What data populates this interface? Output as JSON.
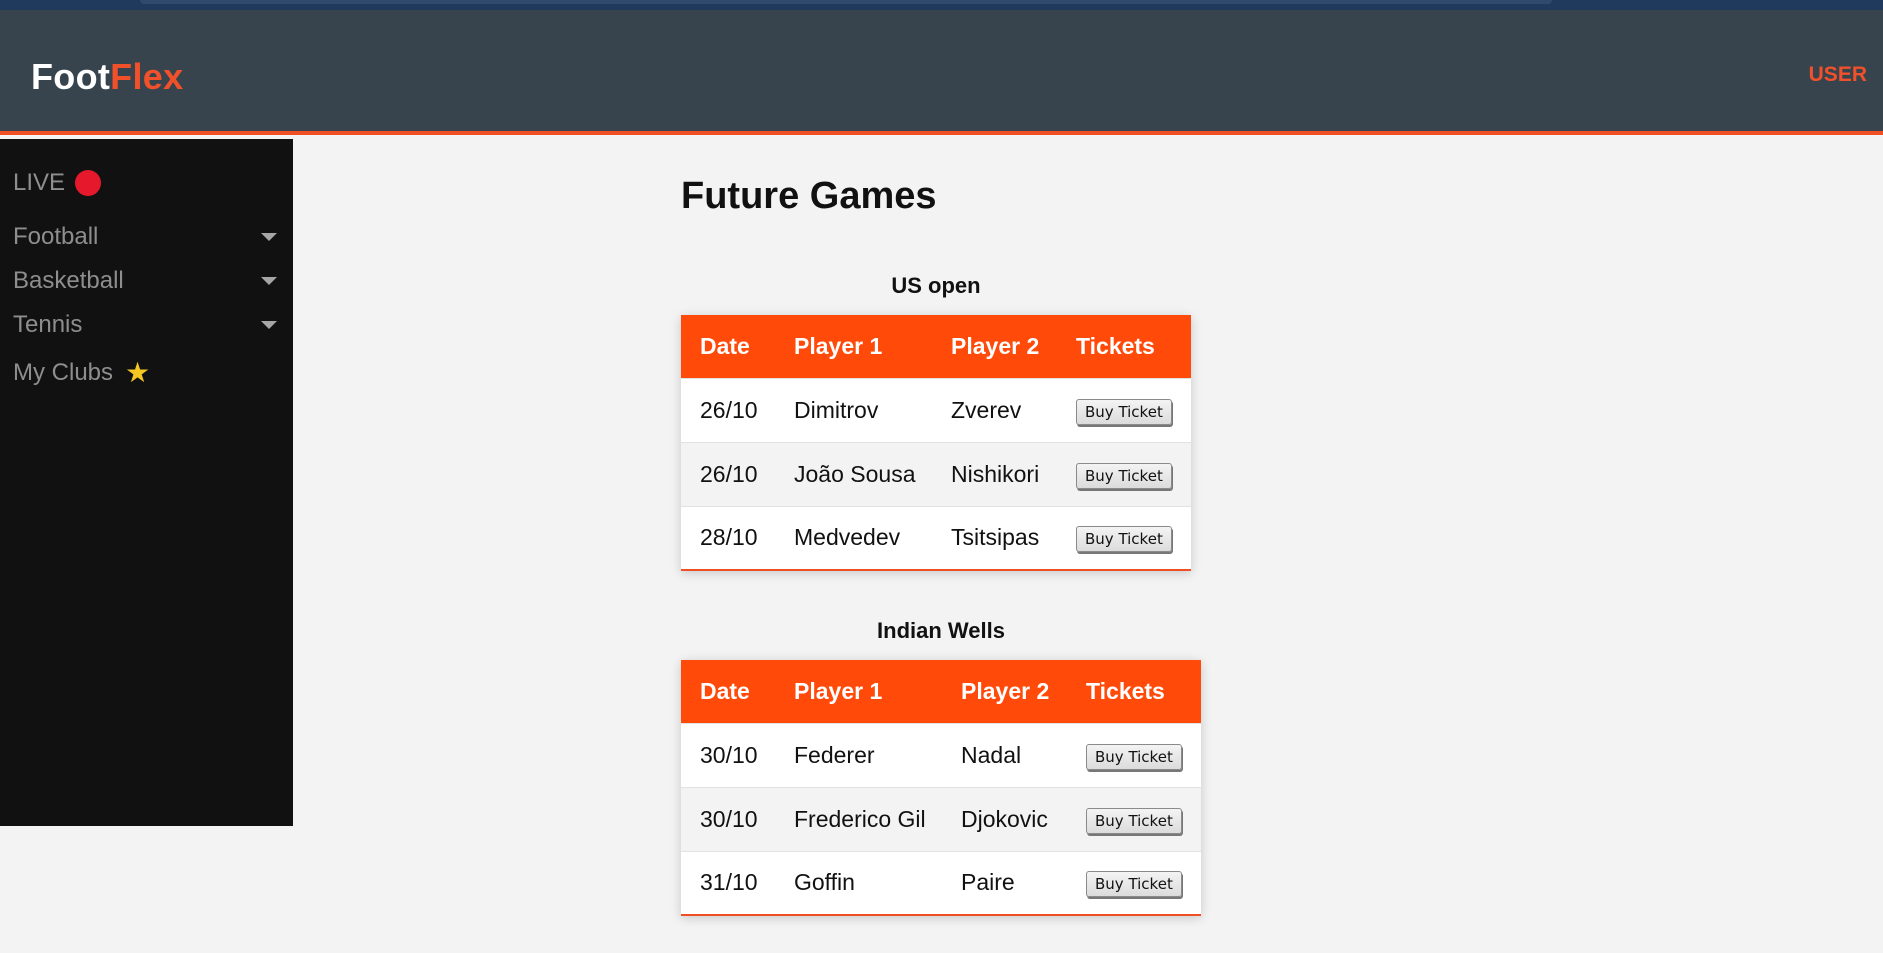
{
  "app": {
    "logo_part1": "Foot",
    "logo_part2": "Flex",
    "user_label": "USER"
  },
  "sidebar": {
    "items": [
      {
        "label": "LIVE",
        "icon": "live-red-dot"
      },
      {
        "label": "Football",
        "icon": "caret-down"
      },
      {
        "label": "Basketball",
        "icon": "caret-down"
      },
      {
        "label": "Tennis",
        "icon": "caret-down"
      },
      {
        "label": "My Clubs",
        "icon": "star"
      }
    ]
  },
  "main": {
    "title": "Future Games",
    "tournaments": [
      {
        "name": "US open",
        "headers": [
          "Date",
          "Player 1",
          "Player 2",
          "Tickets"
        ],
        "rows": [
          {
            "date": "26/10",
            "p1": "Dimitrov",
            "p2": "Zverev",
            "action": "Buy Ticket"
          },
          {
            "date": "26/10",
            "p1": "João Sousa",
            "p2": "Nishikori",
            "action": "Buy Ticket"
          },
          {
            "date": "28/10",
            "p1": "Medvedev",
            "p2": "Tsitsipas",
            "action": "Buy Ticket"
          }
        ]
      },
      {
        "name": "Indian Wells",
        "headers": [
          "Date",
          "Player 1",
          "Player 2",
          "Tickets"
        ],
        "rows": [
          {
            "date": "30/10",
            "p1": "Federer",
            "p2": "Nadal",
            "action": "Buy Ticket"
          },
          {
            "date": "30/10",
            "p1": "Frederico Gil",
            "p2": "Djokovic",
            "action": "Buy Ticket"
          },
          {
            "date": "31/10",
            "p1": "Goffin",
            "p2": "Paire",
            "action": "Buy Ticket"
          }
        ]
      }
    ]
  },
  "colors": {
    "accent": "#ff4a0a",
    "header_bg": "#37444d",
    "sidebar_bg": "#111111",
    "live_dot": "#e6182b",
    "star": "#f3c623"
  }
}
